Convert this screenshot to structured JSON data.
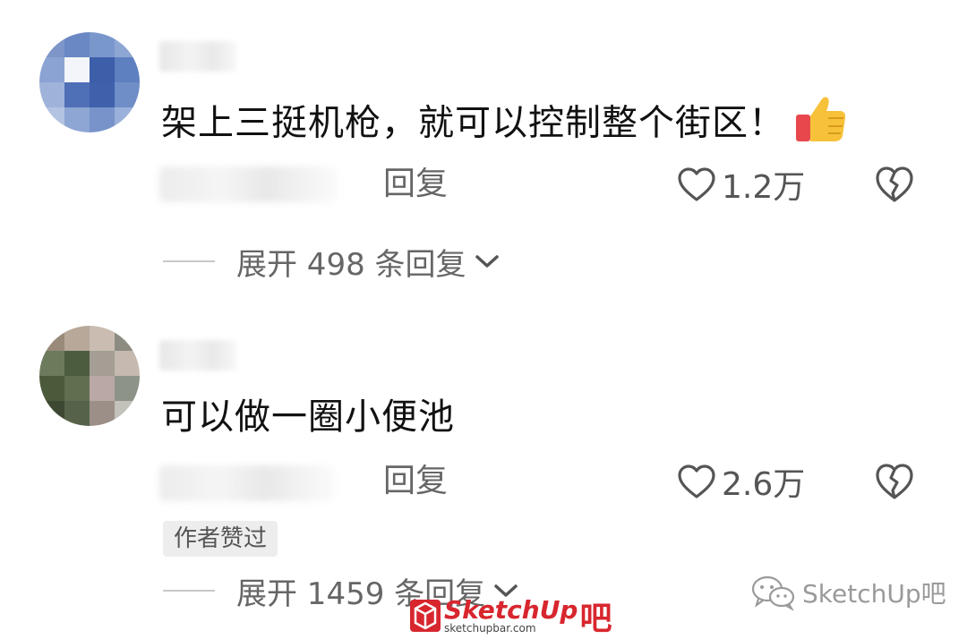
{
  "comments": [
    {
      "text": "架上三挺机枪，就可以控制整个街区！",
      "reply_label": "回复",
      "likes": "1.2万",
      "expand_label": "展开 498 条回复"
    },
    {
      "text": "可以做一圈小便池",
      "reply_label": "回复",
      "likes": "2.6万",
      "badge": "作者赞过",
      "expand_label": "展开 1459 条回复"
    }
  ],
  "watermarks": {
    "center_logo": "SketchUp",
    "center_logo_suffix": "吧",
    "center_url": "sketchupbar.com",
    "right": "SketchUp吧"
  },
  "colors": {
    "accent_red": "#d8262e",
    "text_primary": "#111111",
    "text_secondary": "#666666"
  }
}
